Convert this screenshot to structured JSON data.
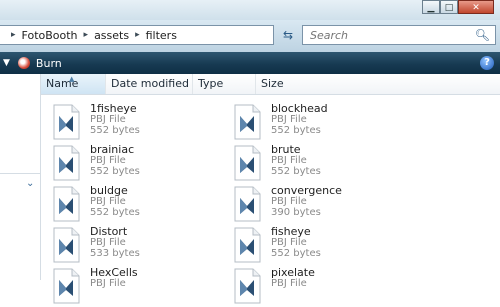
{
  "window": {
    "buttons": {
      "minimize": "▁",
      "maximize": "□",
      "close": "✕"
    }
  },
  "address": {
    "crumbs": [
      "FotoBooth",
      "assets",
      "filters"
    ],
    "separator": "▸"
  },
  "search": {
    "placeholder": "Search"
  },
  "toolbar": {
    "burn_label": "Burn",
    "help_glyph": "?"
  },
  "columns": {
    "name": "Name",
    "date_modified": "Date modified",
    "type": "Type",
    "size": "Size"
  },
  "files": [
    {
      "name": "1fisheye",
      "type": "PBJ File",
      "size": "552 bytes"
    },
    {
      "name": "blockhead",
      "type": "PBJ File",
      "size": "552 bytes"
    },
    {
      "name": "brainiac",
      "type": "PBJ File",
      "size": "552 bytes"
    },
    {
      "name": "brute",
      "type": "PBJ File",
      "size": "552 bytes"
    },
    {
      "name": "buldge",
      "type": "PBJ File",
      "size": "552 bytes"
    },
    {
      "name": "convergence",
      "type": "PBJ File",
      "size": "390 bytes"
    },
    {
      "name": "Distort",
      "type": "PBJ File",
      "size": "533 bytes"
    },
    {
      "name": "fisheye",
      "type": "PBJ File",
      "size": "552 bytes"
    },
    {
      "name": "HexCells",
      "type": "PBJ File",
      "size": ""
    },
    {
      "name": "pixelate",
      "type": "PBJ File",
      "size": ""
    }
  ],
  "colors": {
    "command_bar": "#173a52",
    "accent": "#2b5b86"
  }
}
